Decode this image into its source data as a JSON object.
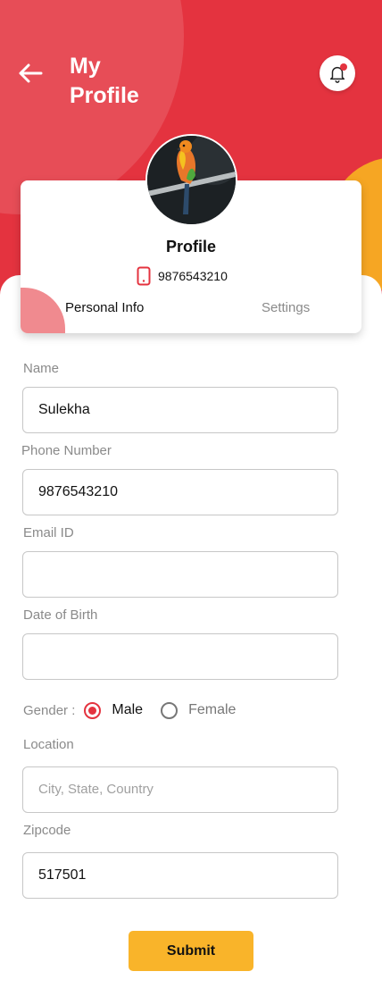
{
  "header": {
    "title": "My\nProfile",
    "back_icon": "arrow-left-icon",
    "notification_icon": "bell-icon",
    "notification_dot": true
  },
  "profile_card": {
    "name": "Profile",
    "phone_icon": "smartphone-icon",
    "phone": "9876543210",
    "avatar_description": "parrot on branch",
    "tabs": [
      {
        "label": "Personal Info",
        "active": true
      },
      {
        "label": "Settings",
        "active": false
      }
    ]
  },
  "form": {
    "name": {
      "label": "Name",
      "value": "Sulekha",
      "placeholder": ""
    },
    "phone": {
      "label": "Phone Number",
      "value": "9876543210",
      "placeholder": ""
    },
    "email": {
      "label": "Email ID",
      "value": "",
      "placeholder": ""
    },
    "dob": {
      "label": "Date of Birth",
      "value": "",
      "placeholder": ""
    },
    "gender": {
      "label": "Gender :",
      "options": [
        {
          "label": "Male",
          "selected": true
        },
        {
          "label": "Female",
          "selected": false
        }
      ]
    },
    "location": {
      "label": "Location",
      "value": "",
      "placeholder": "City, State, Country"
    },
    "zipcode": {
      "label": "Zipcode",
      "value": "517501",
      "placeholder": ""
    },
    "submit_label": "Submit"
  },
  "colors": {
    "primary_red": "#e4333f",
    "accent_yellow": "#f9b42a",
    "blob_pink": "#f08a8f"
  }
}
